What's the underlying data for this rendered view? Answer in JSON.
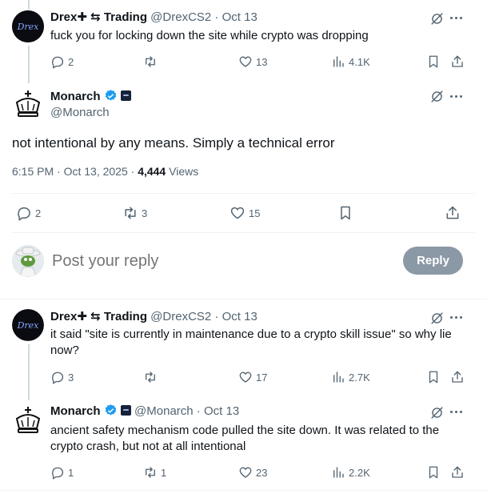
{
  "post1": {
    "name": "Drex✚ ⇆ Trading",
    "handle": "@DrexCS2",
    "sep": "·",
    "date": "Oct 13",
    "text": "fuck you for locking down the site while crypto was dropping",
    "replies": "2",
    "reposts": "",
    "likes": "13",
    "views": "4.1K"
  },
  "main": {
    "name": "Monarch",
    "handle": "@Monarch",
    "text": "not intentional by any means. Simply a technical error",
    "time": "6:15 PM · Oct 13, 2025 · ",
    "views_count": "4,444",
    "views_label": " Views",
    "replies": "2",
    "reposts": "3",
    "likes": "15"
  },
  "composer": {
    "placeholder": "Post your reply",
    "button": "Reply"
  },
  "post2": {
    "name": "Drex✚ ⇆ Trading",
    "handle": "@DrexCS2",
    "sep": "·",
    "date": "Oct 13",
    "text": "it said \"site is currently in maintenance due to a crypto skill issue\" so why lie now?",
    "replies": "3",
    "reposts": "",
    "likes": "17",
    "views": "2.7K"
  },
  "post3": {
    "name": "Monarch",
    "handle": "@Monarch",
    "sep": "·",
    "date": "Oct 13",
    "text": "ancient safety mechanism code pulled the site down. It was related to the crypto crash, but not at all intentional",
    "replies": "1",
    "reposts": "1",
    "likes": "23",
    "views": "2.2K"
  },
  "icons": {
    "verified_color": "#1d9bf0",
    "accent": "#0f1419",
    "muted": "#536471"
  }
}
